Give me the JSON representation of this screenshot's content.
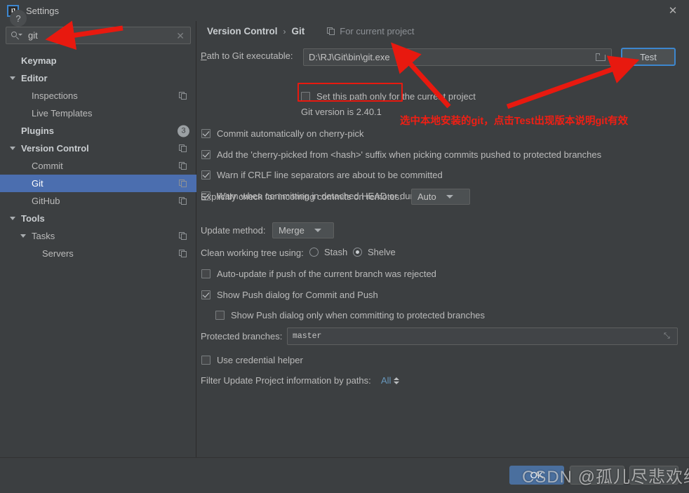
{
  "window": {
    "title": "Settings",
    "logo_text": "IJ",
    "close_label": "✕"
  },
  "sidebar": {
    "search": {
      "value": "git",
      "placeholder": "Search settings",
      "clear_label": "✕"
    },
    "items": [
      {
        "label": "Keymap",
        "indent": 30,
        "bold": true,
        "arrow": false,
        "icon": "none",
        "selected": false
      },
      {
        "label": "Editor",
        "indent": 30,
        "bold": true,
        "arrow": true,
        "icon": "none",
        "selected": false
      },
      {
        "label": "Inspections",
        "indent": 45,
        "bold": false,
        "arrow": false,
        "icon": "copy",
        "selected": false
      },
      {
        "label": "Live Templates",
        "indent": 45,
        "bold": false,
        "arrow": false,
        "icon": "none",
        "selected": false
      },
      {
        "label": "Plugins",
        "indent": 30,
        "bold": true,
        "arrow": false,
        "icon": "badge",
        "selected": false,
        "badge": "3"
      },
      {
        "label": "Version Control",
        "indent": 30,
        "bold": true,
        "arrow": true,
        "icon": "copy",
        "selected": false
      },
      {
        "label": "Commit",
        "indent": 45,
        "bold": false,
        "arrow": false,
        "icon": "copy",
        "selected": false
      },
      {
        "label": "Git",
        "indent": 45,
        "bold": false,
        "arrow": false,
        "icon": "copy",
        "selected": true
      },
      {
        "label": "GitHub",
        "indent": 45,
        "bold": false,
        "arrow": false,
        "icon": "copy",
        "selected": false
      },
      {
        "label": "Tools",
        "indent": 30,
        "bold": true,
        "arrow": true,
        "icon": "none",
        "selected": false
      },
      {
        "label": "Tasks",
        "indent": 45,
        "bold": false,
        "arrow": true,
        "icon": "copy",
        "selected": false
      },
      {
        "label": "Servers",
        "indent": 60,
        "bold": false,
        "arrow": false,
        "icon": "copy",
        "selected": false
      }
    ]
  },
  "main": {
    "breadcrumb": {
      "root": "Version Control",
      "separator": "›",
      "current": "Git",
      "scope_label": "For current project"
    },
    "path_row": {
      "label_prefix": "P",
      "label_rest": "ath to Git executable:",
      "value": "D:\\RJ\\Git\\bin\\git.exe",
      "test_button": "Test"
    },
    "set_path_checkbox": {
      "label": "Set this path only for the current project",
      "checked": false
    },
    "git_version_text": "Git version is 2.40.1",
    "checkboxes": [
      {
        "label": "Commit automatically on cherry-pick",
        "checked": true
      },
      {
        "label": "Add the 'cherry-picked from <hash>' suffix when picking commits pushed to protected branches",
        "checked": true
      },
      {
        "label": "Warn if CRLF line separators are about to be committed",
        "checked": true
      },
      {
        "label": "Warn when committing in detached HEAD or during rebase",
        "checked": true
      }
    ],
    "incoming_commits": {
      "label": "Explicitly check for incoming commits on remotes:",
      "value": "Auto"
    },
    "update_method": {
      "label": "Update method:",
      "value": "Merge"
    },
    "clean_working_tree": {
      "label": "Clean working tree using:",
      "options": [
        {
          "label": "Stash",
          "selected": false
        },
        {
          "label": "Shelve",
          "selected": true
        }
      ]
    },
    "auto_update": {
      "label": "Auto-update if push of the current branch was rejected",
      "checked": false
    },
    "show_push_dialog": {
      "label": "Show Push dialog for Commit and Push",
      "checked": true
    },
    "show_push_dialog_protected": {
      "label": "Show Push dialog only when committing to protected branches",
      "checked": false
    },
    "protected_branches": {
      "label": "Protected branches:",
      "value": "master",
      "expand_icon": "⤡"
    },
    "use_credential_helper": {
      "label": "Use credential helper",
      "checked": false
    },
    "filter_update": {
      "label": "Filter Update Project information by paths:",
      "value": "All"
    }
  },
  "footer": {
    "help_label": "?",
    "ok_label": "OK",
    "cancel_label": "Cancel",
    "apply_label": "Apply"
  },
  "annotations": {
    "note_text": "选中本地安装的git，点击Test出现版本说明git有效",
    "watermark": "CSDN @孤儿尽悲欢绝"
  },
  "colors": {
    "accent_selection": "#4b6eaf",
    "focus_border": "#3d87cf",
    "annotation_red": "#e8190f",
    "link_blue": "#6897bb",
    "panel_bg": "#3c3f41"
  }
}
